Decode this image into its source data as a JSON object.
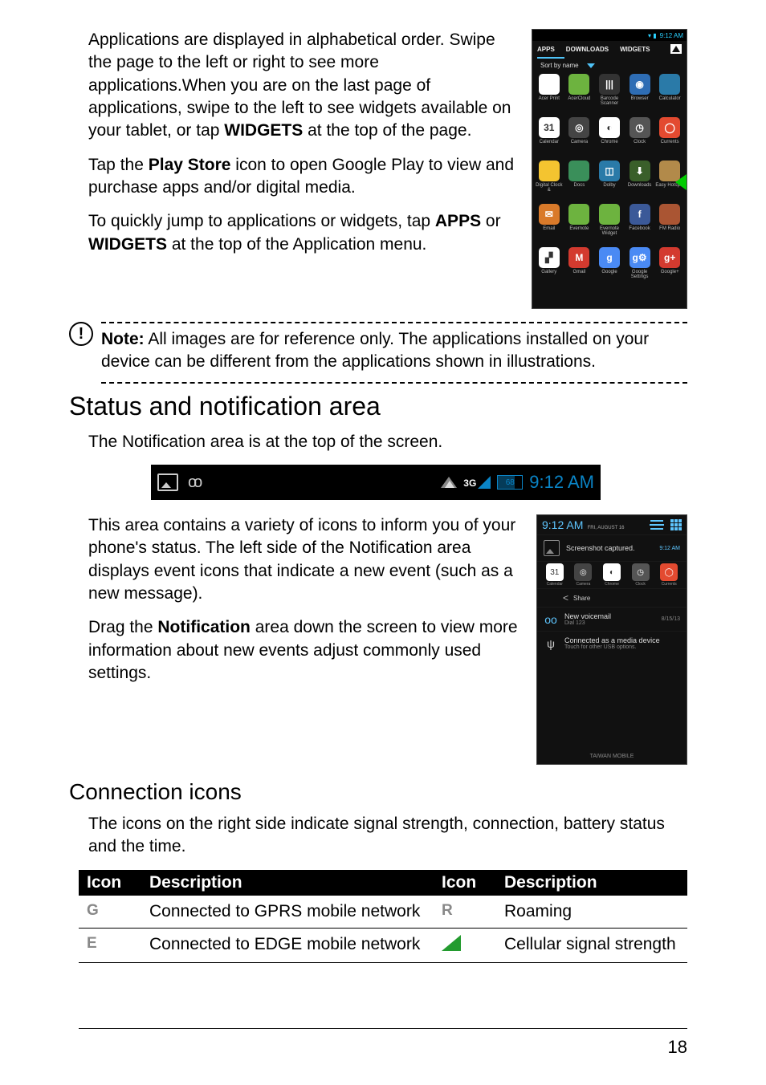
{
  "para1": "Applications are displayed in alphabetical order. Swipe the page to the left or right to see more applications.When you are on the last page of applications, swipe to the left to see widgets available on your tablet, or tap ",
  "para1_bold": "WIDGETS",
  "para1_end": " at the top of the page.",
  "para2a": "Tap the ",
  "para2_bold": "Play Store",
  "para2b": " icon to open Google Play to view and purchase apps and/or digital media.",
  "para3a": "To quickly jump to applications or widgets, tap ",
  "para3_b1": "APPS",
  "para3_mid": " or ",
  "para3_b2": "WIDGETS",
  "para3_end": " at the top of the Application menu.",
  "note_bold": "Note:",
  "note_text": " All images are for reference only. The applications installed on your device can be different from the applications shown in illustrations.",
  "h2_status": "Status and notification area",
  "para4": "The Notification area is at the top of the screen.",
  "para5": "This area contains a variety of icons to inform you of your phone's status. The left side of the Notification area displays event icons that indicate a new event (such as a new message).",
  "para6a": "Drag the ",
  "para6_bold": "Notification",
  "para6b": " area down the screen to view more information about new events adjust commonly used settings.",
  "h2_conn": "Connection icons",
  "para7": "The icons on the right side indicate signal strength, connection, battery status and the time.",
  "table": {
    "h_icon": "Icon",
    "h_desc": "Description",
    "r1a_desc": "Connected to GPRS mobile network",
    "r1b_desc": "Roaming",
    "r2a_desc": "Connected to EDGE mobile network",
    "r2b_desc": "Cellular signal strength",
    "icon_G": "G",
    "icon_E": "E",
    "icon_R": "R"
  },
  "phone1": {
    "time": "9:12 AM",
    "tab_apps": "APPS",
    "tab_downloads": "DOWNLOADS",
    "tab_widgets": "WIDGETS",
    "sort": "Sort by name",
    "apps": [
      {
        "label": "Acer Print",
        "bg": "#fff",
        "glyph": ""
      },
      {
        "label": "AcerCloud",
        "bg": "#6db33f",
        "glyph": ""
      },
      {
        "label": "Barcode Scanner",
        "bg": "#333",
        "glyph": "|||"
      },
      {
        "label": "Browser",
        "bg": "#2e6db4",
        "glyph": "◉"
      },
      {
        "label": "Calculator",
        "bg": "#2a7aa8",
        "glyph": ""
      },
      {
        "label": "Calendar",
        "bg": "#fff",
        "glyph": "31"
      },
      {
        "label": "Camera",
        "bg": "#444",
        "glyph": "◎"
      },
      {
        "label": "Chrome",
        "bg": "#fff",
        "glyph": "◐"
      },
      {
        "label": "Clock",
        "bg": "#555",
        "glyph": "◷"
      },
      {
        "label": "Currents",
        "bg": "#e34a30",
        "glyph": "◯"
      },
      {
        "label": "Digital Clock &",
        "bg": "#f4c430",
        "glyph": ""
      },
      {
        "label": "Docs",
        "bg": "#3a8f5a",
        "glyph": ""
      },
      {
        "label": "Dolby",
        "bg": "#2a7aa8",
        "glyph": "◫"
      },
      {
        "label": "Downloads",
        "bg": "#3a5f2a",
        "glyph": "⬇"
      },
      {
        "label": "Easy Hotspot",
        "bg": "#b28a4a",
        "glyph": ""
      },
      {
        "label": "Email",
        "bg": "#d97a2a",
        "glyph": "✉"
      },
      {
        "label": "Evernote",
        "bg": "#6db33f",
        "glyph": ""
      },
      {
        "label": "Evernote Widget",
        "bg": "#6db33f",
        "glyph": ""
      },
      {
        "label": "Facebook",
        "bg": "#3b5998",
        "glyph": "f"
      },
      {
        "label": "FM Radio",
        "bg": "#aa5533",
        "glyph": ""
      },
      {
        "label": "Gallery",
        "bg": "#fff",
        "glyph": "▞"
      },
      {
        "label": "Gmail",
        "bg": "#d33a2f",
        "glyph": "M"
      },
      {
        "label": "Google",
        "bg": "#4a8af4",
        "glyph": "g"
      },
      {
        "label": "Google Settings",
        "bg": "#4a8af4",
        "glyph": "g⚙"
      },
      {
        "label": "Google+",
        "bg": "#d33a2f",
        "glyph": "g+"
      }
    ]
  },
  "statusbar": {
    "net": "3G",
    "batt": "68",
    "time": "9:12 AM"
  },
  "shade": {
    "time": "9:12 AM",
    "date": "FRI, AUGUST 16",
    "shot": "Screenshot captured.",
    "shot_time": "9:12 AM",
    "qs": [
      {
        "label": "Calendar",
        "bg": "#fff",
        "glyph": "31"
      },
      {
        "label": "Camera",
        "bg": "#444",
        "glyph": "◎"
      },
      {
        "label": "Chrome",
        "bg": "#fff",
        "glyph": "◐"
      },
      {
        "label": "Clock",
        "bg": "#555",
        "glyph": "◷"
      },
      {
        "label": "Currents",
        "bg": "#e34a30",
        "glyph": "◯"
      }
    ],
    "share": "Share",
    "vm_title": "New voicemail",
    "vm_sub": "Dial 123",
    "vm_time": "8/15/13",
    "usb_title": "Connected as a media device",
    "usb_sub": "Touch for other USB options.",
    "carrier": "TAIWAN MOBILE"
  },
  "page_num": "18"
}
